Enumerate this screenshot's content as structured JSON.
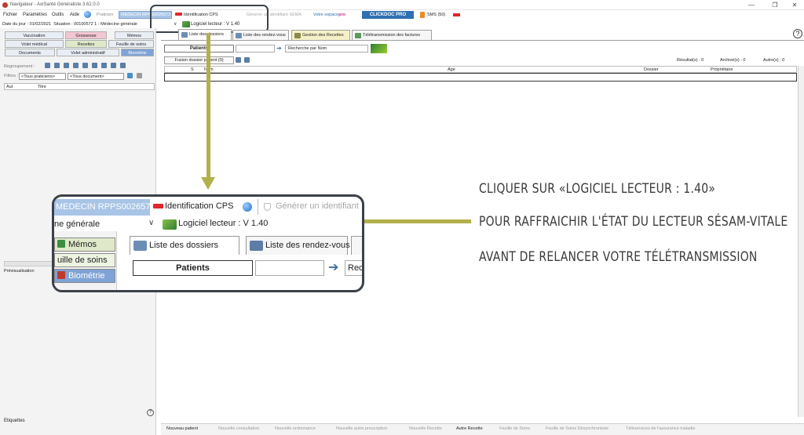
{
  "window": {
    "title": "Navigateur - AxiSanté Généraliste 3.62.0.0",
    "minimize": "—",
    "restore": "❐",
    "close": "✕"
  },
  "menu": [
    "Fichier",
    "Paramètres",
    "Outils",
    "Aide"
  ],
  "toolbar": {
    "praticien_label": "Praticien",
    "praticien_value": "MEDECIN RPPS0026572",
    "identification_cps": "Identification CPS",
    "generer_identifiant": "Générer un identifiant SEMA",
    "votre_espace": "Votre espace",
    "votre_espace_brand": "pro",
    "clickdoc": "CLICKDOC PRO",
    "sms": "SMS (50)"
  },
  "status_line": {
    "date_label": "Date du jour :",
    "date_value": "01/02/2021",
    "situation_label": "Situation :",
    "situation_value": "00100572 1 - Médecine générale",
    "dropdown_glyph": "∨",
    "logiciel_lecteur": "Logiciel lecteur : V 1.40"
  },
  "left_tabs": {
    "row1": [
      "Vaccination",
      "Grossesse",
      "Mémos"
    ],
    "row2": [
      "Volet médical",
      "Recettes",
      "Feuille de soins"
    ],
    "row3": [
      "Documents",
      "Volet administratif",
      "Biométrie"
    ]
  },
  "left_panel": {
    "regroupement": "Regroupement :",
    "filtres": "Filtres :",
    "filter_praticiens": "<Tous praticiens>",
    "filter_documents": "<Tous document>",
    "grid_cols": [
      "Aut",
      "Titre"
    ],
    "previsualisation": "Prévisualisation",
    "etiquettes": "Etiquettes"
  },
  "main_tabs": [
    "Liste des dossiers",
    "Liste des rendez-vous",
    "Gestion des Recettes",
    "Télétransmission des factures"
  ],
  "search": {
    "patients": "Patients",
    "recherche": "Recherche par Nom",
    "fusion": "Fusion dossier patient (0)"
  },
  "results": {
    "resultats": "Résultat(s) : 0",
    "archives": "Archivé(s) : 0",
    "autres": "Autre(s) : 0"
  },
  "grid_columns": [
    "S",
    "Nom",
    "Age",
    "Dossier",
    "Propriétaire"
  ],
  "bottom_bar": [
    {
      "label": "Nouveau patient",
      "enabled": true
    },
    {
      "label": "Nouvelle consultation",
      "enabled": false
    },
    {
      "label": "Nouvelle ordonnance",
      "enabled": false
    },
    {
      "label": "Nouvelle autre prescription",
      "enabled": false
    },
    {
      "label": "Nouvelle Recette",
      "enabled": false
    },
    {
      "label": "Autre Recette",
      "enabled": true
    },
    {
      "label": "Feuille de Soins",
      "enabled": false
    },
    {
      "label": "Feuille de Soins Désynchronisée",
      "enabled": false
    },
    {
      "label": "Téléservices de l'assurance maladie",
      "enabled": false
    }
  ],
  "callout": {
    "praticien": "MEDECIN RPPS0026572",
    "identification_cps": "Identification CPS",
    "generer": "Générer un identifiant",
    "situation": "ne générale",
    "logiciel_lecteur": "Logiciel lecteur : V 1.40",
    "memos": "Mémos",
    "feuille": "uille de soins",
    "biometrie": "Biométrie",
    "liste_dossiers": "Liste des dossiers",
    "liste_rdv": "Liste des rendez-vous",
    "patients": "Patients",
    "rec": "Rec"
  },
  "instructions": [
    "CLIQUER SUR «LOGICIEL LECTEUR : 1.40»",
    "POUR RAFFRAICHIR L'ÉTAT DU LECTEUR SÉSAM-VITALE",
    "AVANT DE RELANCER VOTRE TÉLÉTRANSMISSION"
  ],
  "colors": {
    "arrow": "#b1b04c",
    "highlight_border": "#39424a",
    "praticien_bg": "#a8c4e6",
    "clickdoc_bg": "#2f6fb3"
  }
}
